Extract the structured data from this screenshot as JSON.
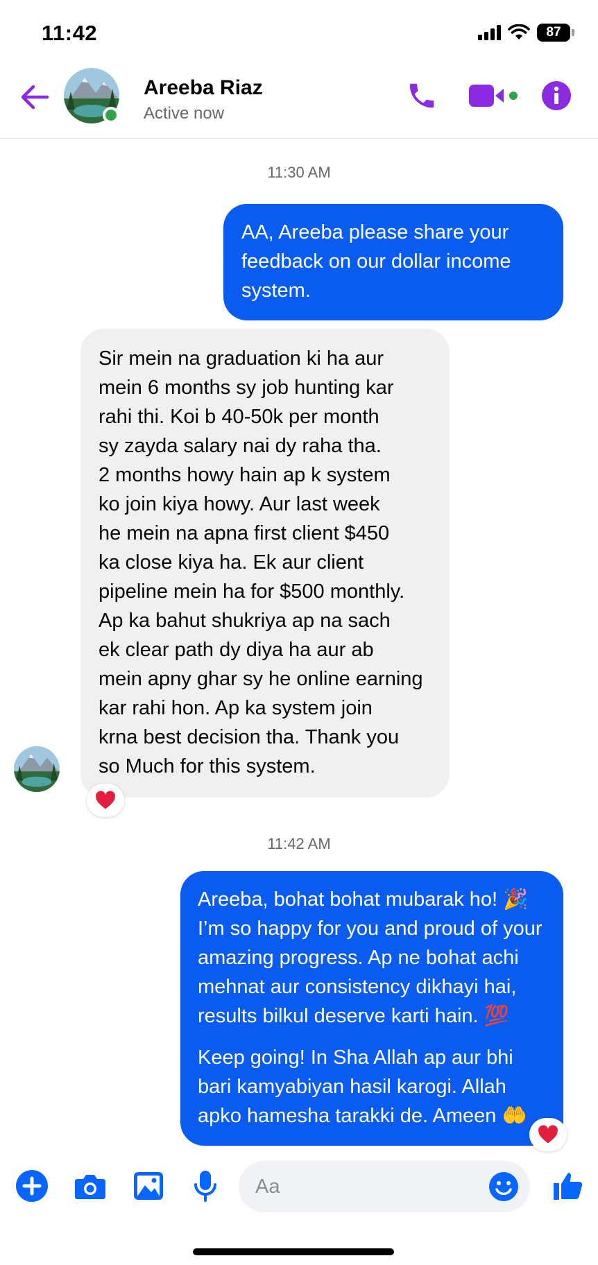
{
  "status_bar": {
    "time": "11:42",
    "battery": "87",
    "icons": [
      "cellular-signal-icon",
      "wifi-icon",
      "battery-icon"
    ]
  },
  "header": {
    "contact_name": "Areeba Riaz",
    "status": "Active now",
    "icons": [
      "back-arrow-icon",
      "phone-icon",
      "video-camera-icon",
      "info-icon"
    ],
    "accent_color": "#8a2be2"
  },
  "conversation": {
    "timestamp_1": "11:30 AM",
    "message_1": {
      "direction": "outgoing",
      "lines": [
        "AA, Areeba please share your",
        "feedback on our dollar income",
        "system."
      ]
    },
    "message_2": {
      "direction": "incoming",
      "lines": [
        "Sir mein na graduation ki ha aur",
        "mein 6 months sy job hunting kar",
        "rahi thi. Koi b 40-50k per month",
        "sy zayda salary nai dy raha tha.",
        "2 months howy hain ap k system",
        "ko join kiya howy. Aur last week",
        "he mein na apna first client $450",
        "ka close kiya ha. Ek aur client",
        "pipeline mein ha for $500 monthly.",
        "Ap ka bahut shukriya ap na sach",
        "ek clear path dy diya ha aur ab",
        "mein apny ghar sy he online earning",
        "kar rahi hon. Ap ka system join",
        "krna best decision tha. Thank you",
        "so Much for this system."
      ],
      "reaction": "heart"
    },
    "timestamp_2": "11:42 AM",
    "message_3": {
      "direction": "outgoing",
      "paragraph_1": [
        "Areeba, bohat bohat mubarak ho! 🎉",
        "I’m so happy for you and proud of your",
        "amazing progress. Ap ne bohat achi",
        "mehnat aur consistency dikhayi hai,",
        "results bilkul deserve karti hain. 💯"
      ],
      "paragraph_2": [
        "Keep going! In Sha Allah ap aur bhi",
        "bari kamyabiyan hasil karogi. Allah",
        "apko hamesha tarakki de. Ameen 🤲"
      ],
      "reaction": "heart"
    },
    "outgoing_bubble_color": "#0a5cf1",
    "incoming_bubble_color": "#f0f0f0"
  },
  "composer": {
    "placeholder": "Aa",
    "icons": [
      "plus-icon",
      "camera-icon",
      "gallery-icon",
      "microphone-icon",
      "emoji-icon",
      "thumbs-up-icon"
    ],
    "accent_color": "#0866ff"
  }
}
